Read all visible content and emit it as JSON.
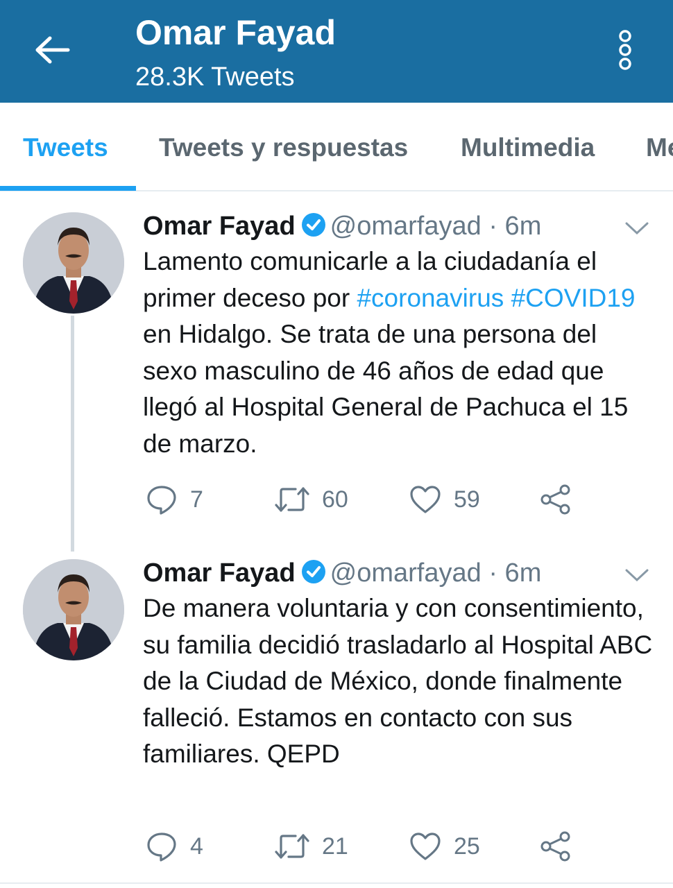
{
  "header": {
    "title": "Omar Fayad",
    "subtitle": "28.3K Tweets",
    "color": "#1a6ea1",
    "back_icon": "arrow-left-icon",
    "more_icon": "more-vertical-icon"
  },
  "tabs": [
    {
      "label": "Tweets",
      "active": true
    },
    {
      "label": "Tweets y respuestas",
      "active": false
    },
    {
      "label": "Multimedia",
      "active": false
    },
    {
      "label": "Me",
      "active": false
    }
  ],
  "accent_color": "#1da1f2",
  "tweets": [
    {
      "name": "Omar Fayad",
      "handle": "@omarfayad",
      "time": "· 6m",
      "text_parts": [
        {
          "text": "Lamento comunicarle a la ciudadanía el primer deceso por ",
          "hashtag": false
        },
        {
          "text": "#coronavirus",
          "hashtag": true
        },
        {
          "text": " ",
          "hashtag": false
        },
        {
          "text": "#COVID19",
          "hashtag": true
        },
        {
          "text": " en Hidalgo. Se trata de una persona del sexo masculino de 46 años de edad que llegó al Hospital General de Pachuca el 15 de marzo.",
          "hashtag": false
        }
      ],
      "replies": "7",
      "retweets": "60",
      "likes": "59"
    },
    {
      "name": "Omar Fayad",
      "handle": "@omarfayad",
      "time": "· 6m",
      "text_parts": [
        {
          "text": "De manera voluntaria y con consentimiento, su familia decidió trasladarlo al Hospital ABC de la Ciudad de México, donde finalmente falleció. Estamos en contacto con sus familiares. QEPD",
          "hashtag": false
        }
      ],
      "replies": "4",
      "retweets": "21",
      "likes": "25"
    }
  ]
}
